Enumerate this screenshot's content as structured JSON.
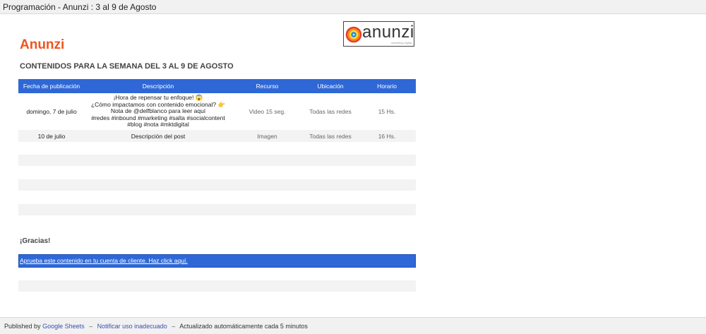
{
  "window": {
    "title": "Programación - Anunzi : 3 al 9 de Agosto"
  },
  "brand": {
    "name": "Anunzi"
  },
  "logo": {
    "word": "anunzi",
    "tagline": "marketing digital"
  },
  "heading": "CONTENIDOS PARA LA SEMANA DEL 3 AL 9 DE AGOSTO",
  "table": {
    "headers": [
      "Fecha de publicación",
      "Descripción",
      "Recurso",
      "Ubicación",
      "Horario"
    ],
    "rows": [
      {
        "date": "domingo, 7 de julio",
        "description_lines": [
          "¡Hora de repensar tu enfoque! 😱",
          "¿Cómo impactamos con contenido emocional? 👉",
          "Nota de @delfblanco para leer aquí",
          "#redes #inbound #marketing #salta #socialcontent",
          "#blog #nota #mktdigital"
        ],
        "resource": "Video 15 seg.",
        "location": "Todas las redes",
        "time": "15 Hs."
      },
      {
        "date": "10 de julio",
        "description_lines": [
          "Descripción del post"
        ],
        "resource": "Imagen",
        "location": "Todas las redes",
        "time": "16 Hs."
      }
    ]
  },
  "thanks": "¡Gracias!",
  "cta": {
    "label": "Aprueba este contenido en tu cuenta de cliente. Haz click aquí."
  },
  "footer": {
    "published_prefix": "Published by",
    "published_link": "Google Sheets",
    "separator": "–",
    "report_link": "Notificar uso inadecuado",
    "auto_update": "Actualizado automáticamente cada 5 minutos"
  },
  "colors": {
    "brand": "#f0541f",
    "header_blue": "#2f68d6",
    "stripe": "#f3f3f3"
  }
}
